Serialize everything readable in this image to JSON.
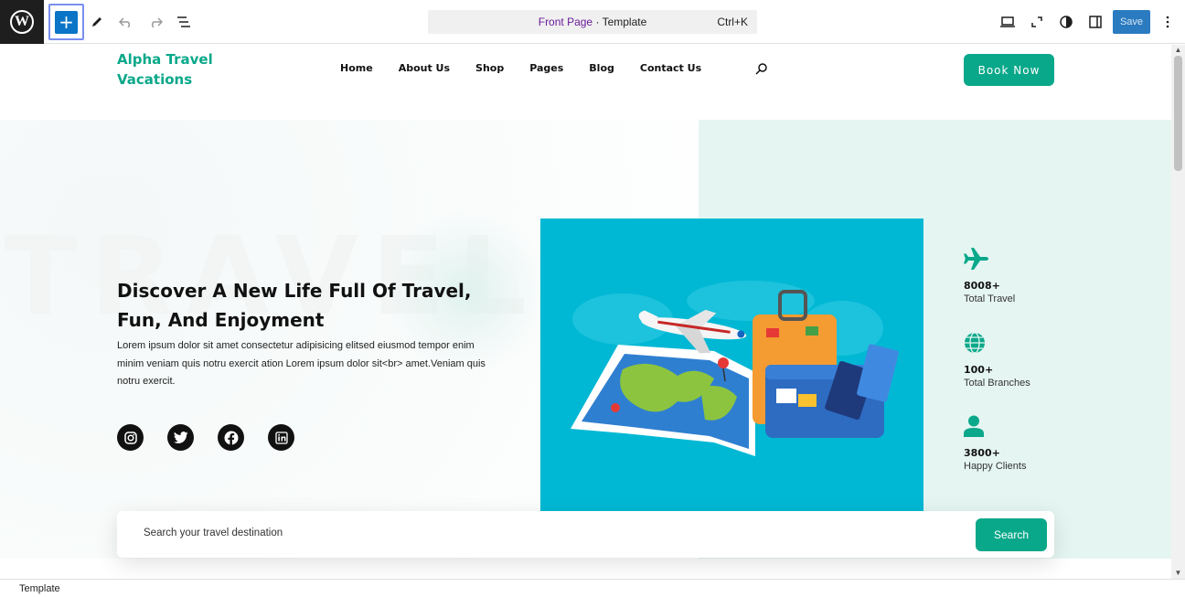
{
  "editor": {
    "document_title": "Front Page",
    "document_type": "Template",
    "separator": " · ",
    "shortcut": "Ctrl+K",
    "save_label": "Save",
    "add_label": "+"
  },
  "site": {
    "brand": "Alpha Travel Vacations",
    "nav": [
      {
        "label": "Home"
      },
      {
        "label": "About Us"
      },
      {
        "label": "Shop"
      },
      {
        "label": "Pages"
      },
      {
        "label": "Blog"
      },
      {
        "label": "Contact Us"
      }
    ],
    "book_label": "Book Now"
  },
  "hero": {
    "watermark": "TRAVEL",
    "title": "Discover A New Life Full Of Travel, Fun, And Enjoyment",
    "description": "Lorem ipsum dolor sit amet consectetur adipisicing elitsed eiusmod tempor enim minim veniam quis notru exercit ation Lorem ipsum dolor sit<br> amet.Veniam quis notru exercit.",
    "socials": [
      "instagram-icon",
      "twitter-icon",
      "facebook-icon",
      "linkedin-icon"
    ]
  },
  "stats": [
    {
      "icon": "airplane-icon",
      "value": "8008+",
      "label": "Total Travel"
    },
    {
      "icon": "globe-icon",
      "value": "100+",
      "label": "Total Branches"
    },
    {
      "icon": "user-icon",
      "value": "3800+",
      "label": "Happy Clients"
    }
  ],
  "search": {
    "placeholder": "Search your travel destination",
    "button_label": "Search"
  },
  "footer": {
    "breadcrumb": "Template"
  },
  "colors": {
    "accent": "#0aa88a",
    "wp_blue": "#0a74c6",
    "photo_bg": "#00b8d4",
    "hero_right_bg": "#e5f5f2"
  }
}
